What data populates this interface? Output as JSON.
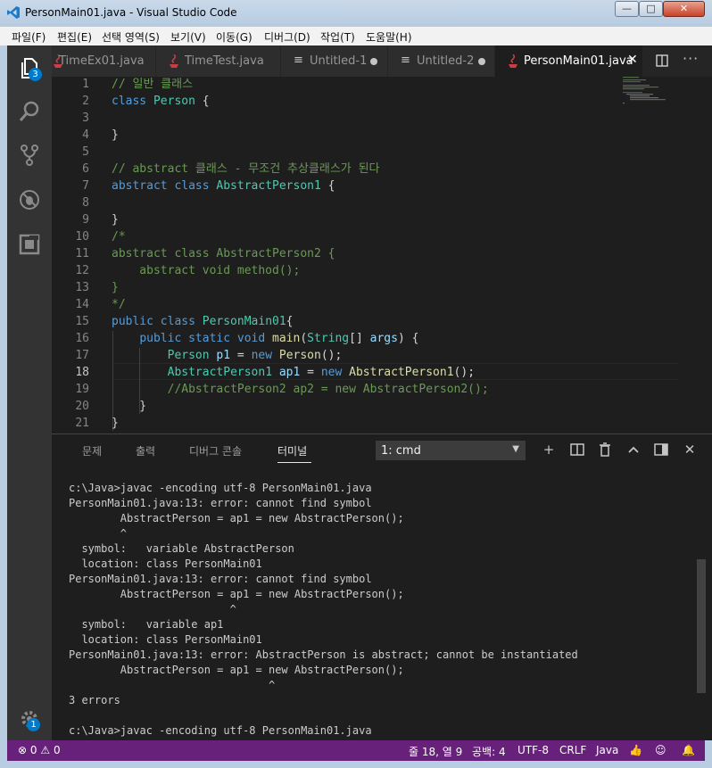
{
  "window": {
    "title": "PersonMain01.java - Visual Studio Code",
    "controls": {
      "minimize": "—",
      "maximize": "□",
      "close": "✕"
    }
  },
  "menu": [
    "파일(F)",
    "편집(E)",
    "선택 영역(S)",
    "보기(V)",
    "이동(G)",
    "디버그(D)",
    "작업(T)",
    "도움말(H)"
  ],
  "activity": {
    "explorer_badge": "3",
    "settings_badge": "1"
  },
  "tabs": [
    {
      "label": "TimeEx01.java",
      "state": "normal"
    },
    {
      "label": "TimeTest.java",
      "state": "normal"
    },
    {
      "label": "Untitled-1",
      "state": "dirty"
    },
    {
      "label": "Untitled-2",
      "state": "dirty"
    },
    {
      "label": "PersonMain01.java",
      "state": "active"
    }
  ],
  "tab_close": "✕",
  "editor": {
    "current_line": 18,
    "lines": [
      {
        "n": "1",
        "tokens": [
          [
            "c",
            "// 일반 클래스"
          ]
        ]
      },
      {
        "n": "2",
        "tokens": [
          [
            "k",
            "class "
          ],
          [
            "t",
            "Person"
          ],
          [
            "p",
            " {"
          ]
        ]
      },
      {
        "n": "3",
        "tokens": []
      },
      {
        "n": "4",
        "tokens": [
          [
            "p",
            "}"
          ]
        ]
      },
      {
        "n": "5",
        "tokens": []
      },
      {
        "n": "6",
        "tokens": [
          [
            "c",
            "// abstract 클래스 - 무조건 추상클래스가 된다"
          ]
        ]
      },
      {
        "n": "7",
        "tokens": [
          [
            "k",
            "abstract class "
          ],
          [
            "t",
            "AbstractPerson1"
          ],
          [
            "p",
            " {"
          ]
        ]
      },
      {
        "n": "8",
        "tokens": []
      },
      {
        "n": "9",
        "tokens": [
          [
            "p",
            "}"
          ]
        ]
      },
      {
        "n": "10",
        "tokens": [
          [
            "c",
            "/*"
          ]
        ]
      },
      {
        "n": "11",
        "tokens": [
          [
            "c",
            "abstract class AbstractPerson2 {"
          ]
        ]
      },
      {
        "n": "12",
        "tokens": [
          [
            "c",
            "    abstract void method();"
          ]
        ]
      },
      {
        "n": "13",
        "tokens": [
          [
            "c",
            "}"
          ]
        ]
      },
      {
        "n": "14",
        "tokens": [
          [
            "c",
            "*/"
          ]
        ]
      },
      {
        "n": "15",
        "tokens": [
          [
            "k",
            "public class "
          ],
          [
            "t",
            "PersonMain01"
          ],
          [
            "p",
            "{"
          ]
        ]
      },
      {
        "n": "16",
        "tokens": [
          [
            "p",
            "    "
          ],
          [
            "k",
            "public static void "
          ],
          [
            "f",
            "main"
          ],
          [
            "p",
            "("
          ],
          [
            "t",
            "String"
          ],
          [
            "p",
            "[] "
          ],
          [
            "v",
            "args"
          ],
          [
            "p",
            ") {"
          ]
        ]
      },
      {
        "n": "17",
        "tokens": [
          [
            "p",
            "        "
          ],
          [
            "t",
            "Person "
          ],
          [
            "v",
            "p1"
          ],
          [
            "p",
            " = "
          ],
          [
            "k",
            "new "
          ],
          [
            "f",
            "Person"
          ],
          [
            "p",
            "();"
          ]
        ]
      },
      {
        "n": "18",
        "tokens": [
          [
            "p",
            "        "
          ],
          [
            "t",
            "AbstractPerson1 "
          ],
          [
            "v",
            "ap1"
          ],
          [
            "p",
            " = "
          ],
          [
            "k",
            "new "
          ],
          [
            "f",
            "AbstractPerson1"
          ],
          [
            "p",
            "();"
          ]
        ]
      },
      {
        "n": "19",
        "tokens": [
          [
            "p",
            "        "
          ],
          [
            "c",
            "//AbstractPerson2 ap2 = new AbstractPerson2();"
          ]
        ]
      },
      {
        "n": "20",
        "tokens": [
          [
            "p",
            "    }"
          ]
        ]
      },
      {
        "n": "21",
        "tokens": [
          [
            "p",
            "}"
          ]
        ]
      }
    ]
  },
  "panel": {
    "tabs": [
      "문제",
      "출력",
      "디버그 콘솔",
      "터미널"
    ],
    "terminal_select": "1: cmd",
    "terminal": [
      "c:\\Java>javac -encoding utf-8 PersonMain01.java",
      "PersonMain01.java:13: error: cannot find symbol",
      "        AbstractPerson = ap1 = new AbstractPerson();",
      "        ^",
      "  symbol:   variable AbstractPerson",
      "  location: class PersonMain01",
      "PersonMain01.java:13: error: cannot find symbol",
      "        AbstractPerson = ap1 = new AbstractPerson();",
      "                         ^",
      "  symbol:   variable ap1",
      "  location: class PersonMain01",
      "PersonMain01.java:13: error: AbstractPerson is abstract; cannot be instantiated",
      "        AbstractPerson = ap1 = new AbstractPerson();",
      "                               ^",
      "3 errors",
      "",
      "c:\\Java>javac -encoding utf-8 PersonMain01.java"
    ]
  },
  "status": {
    "errors": "0",
    "warnings": "0",
    "position": "줄 18, 열 9",
    "indent": "공백: 4",
    "encoding": "UTF-8",
    "eol": "CRLF",
    "language": "Java"
  },
  "colors": {
    "statusbar": "#68217a",
    "accent": "#007acc"
  }
}
